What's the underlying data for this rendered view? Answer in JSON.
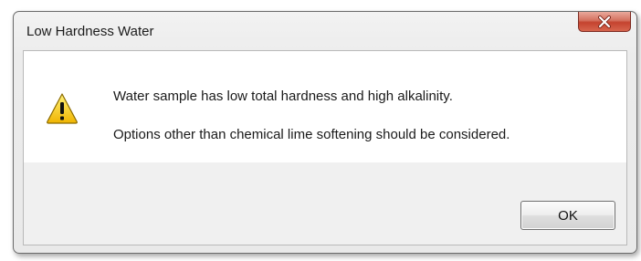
{
  "dialog": {
    "title": "Low Hardness Water",
    "icon": "warning-icon",
    "messages": [
      "Water sample has low total hardness and high alkalinity.",
      "Options other than chemical lime softening should be considered."
    ],
    "ok_label": "OK",
    "close_icon": "close-icon"
  },
  "colors": {
    "close_button": "#c94a36",
    "warning_fill": "#f2c200",
    "content_background": "#ffffff",
    "footer_background": "#f0f0f0"
  }
}
